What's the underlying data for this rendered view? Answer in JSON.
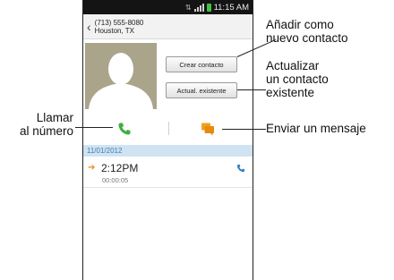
{
  "status_bar": {
    "time": "11:15 AM"
  },
  "contact": {
    "number": "(713) 555-8080",
    "location": "Houston, TX"
  },
  "buttons": {
    "create": "Crear contacto",
    "update": "Actual. existente"
  },
  "call_log": {
    "date": "11/01/2012",
    "time": "2:12PM",
    "duration": "00:00:05"
  },
  "annotations": {
    "add_new_line1": "Añadir como",
    "add_new_line2": "nuevo contacto",
    "update_line1": "Actualizar",
    "update_line2": "un contacto",
    "update_line3": "existente",
    "call_line1": "Llamar",
    "call_line2": "al número",
    "send_message": "Enviar un mensaje"
  },
  "colors": {
    "call_green": "#3fae3f",
    "message_orange": "#f0a21a",
    "date_bar": "#cfe3f3",
    "outgoing_arrow": "#f08a1a"
  }
}
